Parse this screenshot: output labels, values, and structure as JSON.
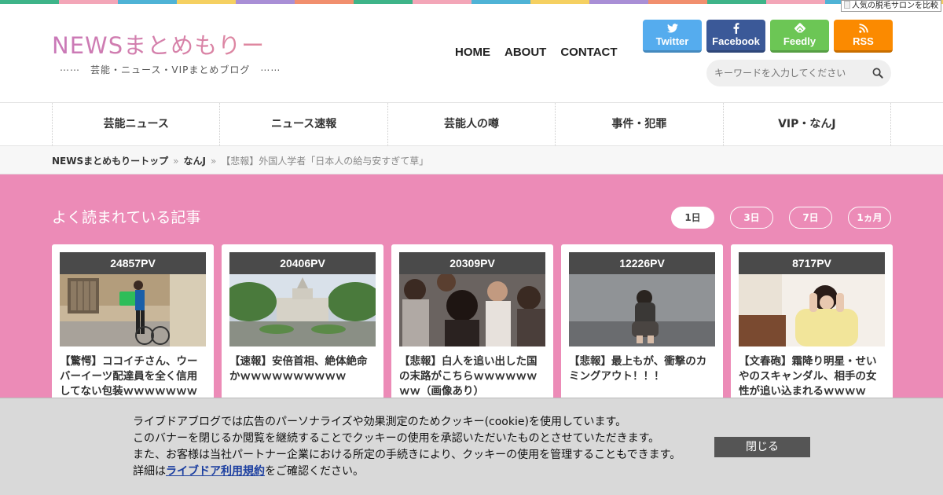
{
  "stripe_colors": [
    "#3eb489",
    "#f3a6b8",
    "#4fb3d6",
    "#f5d061",
    "#a98fd6",
    "#f18f6e",
    "#3eb489",
    "#f3a6b8",
    "#4fb3d6",
    "#f5d061",
    "#a98fd6",
    "#f18f6e",
    "#3eb489",
    "#f3a6b8",
    "#4fb3d6",
    "#f5d061"
  ],
  "ad_label": "人気の脱毛サロンを比較",
  "site": {
    "logo": "NEWSまとめもりー",
    "tagline": "⋯⋯　芸能・ニュース・VIPまとめブログ　⋯⋯"
  },
  "nav": {
    "home": "HOME",
    "about": "ABOUT",
    "contact": "CONTACT"
  },
  "social": {
    "twitter": "Twitter",
    "facebook": "Facebook",
    "feedly": "Feedly",
    "rss": "RSS"
  },
  "search": {
    "placeholder": "キーワードを入力してください"
  },
  "categories": [
    "芸能ニュース",
    "ニュース速報",
    "芸能人の噂",
    "事件・犯罪",
    "VIP・なんJ"
  ],
  "breadcrumb": {
    "home": "NEWSまとめもりートップ",
    "category": "なんJ",
    "current": "【悲報】外国人学者「日本人の給与安すぎて草」",
    "sep": "»"
  },
  "popular": {
    "title": "よく読まれている記事",
    "periods": [
      "1日",
      "3日",
      "7日",
      "1ヵ月"
    ],
    "active_period": "1日",
    "articles": [
      {
        "pv": "24857PV",
        "title": "【驚愕】ココイチさん、ウーバーイーツ配達員を全く信用してない包装ｗｗｗｗｗｗｗ"
      },
      {
        "pv": "20406PV",
        "title": "【速報】安倍首相、絶体絶命かｗｗｗｗｗｗｗｗｗｗ"
      },
      {
        "pv": "20309PV",
        "title": "【悲報】白人を追い出した国の末路がこちらｗｗｗｗｗｗｗｗ（画像あり）"
      },
      {
        "pv": "12226PV",
        "title": "【悲報】最上もが、衝撃のカミングアウト！！！"
      },
      {
        "pv": "8717PV",
        "title": "【文春砲】霜降り明星・せいやのスキャンダル、相手の女性が追い込まれるｗｗｗｗ"
      }
    ]
  },
  "cookie": {
    "line1": "ライブドアブログでは広告のパーソナライズや効果測定のためクッキー(cookie)を使用しています。",
    "line2": "このバナーを閉じるか閲覧を継続することでクッキーの使用を承認いただいたものとさせていただきます。",
    "line3": "また、お客様は当社パートナー企業における所定の手続きにより、クッキーの使用を管理することもできます。",
    "line4_prefix": "詳細は",
    "link": "ライブドア利用規約",
    "line4_suffix": "をご確認ください。",
    "close": "閉じる"
  }
}
